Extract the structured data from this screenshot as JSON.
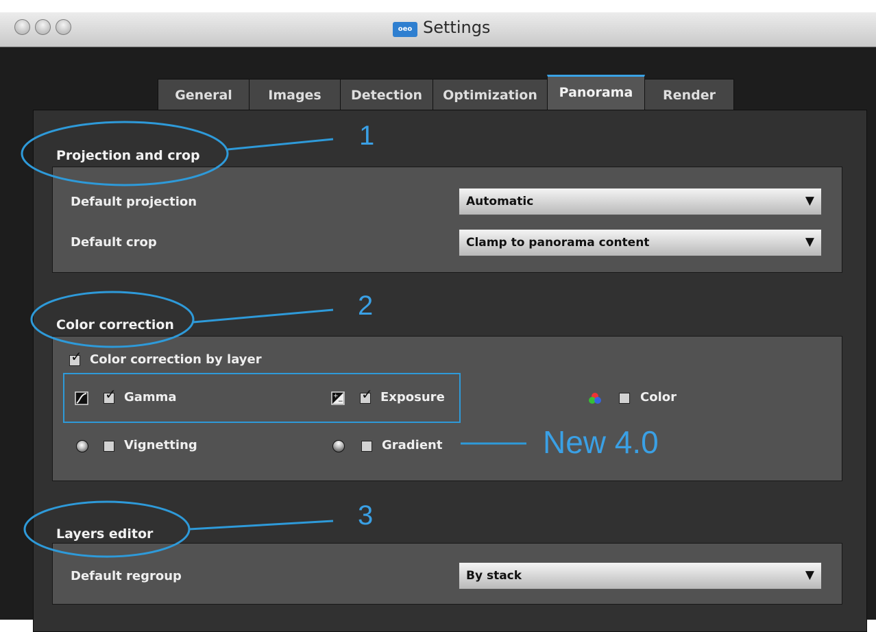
{
  "window": {
    "title": "Settings",
    "app_icon_text": "oeo"
  },
  "tabs": [
    {
      "label": "General"
    },
    {
      "label": "Images"
    },
    {
      "label": "Detection"
    },
    {
      "label": "Optimization"
    },
    {
      "label": "Panorama",
      "active": true
    },
    {
      "label": "Render"
    }
  ],
  "projection": {
    "title": "Projection and crop",
    "default_projection_label": "Default projection",
    "default_projection_value": "Automatic",
    "default_crop_label": "Default crop",
    "default_crop_value": "Clamp to panorama content"
  },
  "color_correction": {
    "title": "Color correction",
    "by_layer_label": "Color correction by layer",
    "by_layer_checked": true,
    "gamma_label": "Gamma",
    "gamma_checked": true,
    "exposure_label": "Exposure",
    "exposure_checked": true,
    "color_label": "Color",
    "color_checked": false,
    "vignetting_label": "Vignetting",
    "vignetting_checked": false,
    "gradient_label": "Gradient",
    "gradient_checked": false
  },
  "layers": {
    "title": "Layers editor",
    "default_regroup_label": "Default regroup",
    "default_regroup_value": "By stack"
  },
  "annotations": {
    "one": "1",
    "two": "2",
    "three": "3",
    "new": "New 4.0"
  },
  "icons": {
    "close_button": "traffic-light-close",
    "minimize_button": "traffic-light-minimize",
    "zoom_button": "traffic-light-zoom",
    "dropdown_arrow": "triangle-down",
    "checkmark": "check",
    "gamma_icon": "gamma-curve",
    "exposure_icon": "exposure-plus-minus",
    "color_icon": "rgb-circles",
    "vignetting_icon": "sphere",
    "gradient_icon": "sphere-gradient"
  },
  "colors": {
    "annotation_blue": "#3aa0e5",
    "active_tab_accent": "#3aa3e6",
    "background": "#1d1d1d"
  }
}
